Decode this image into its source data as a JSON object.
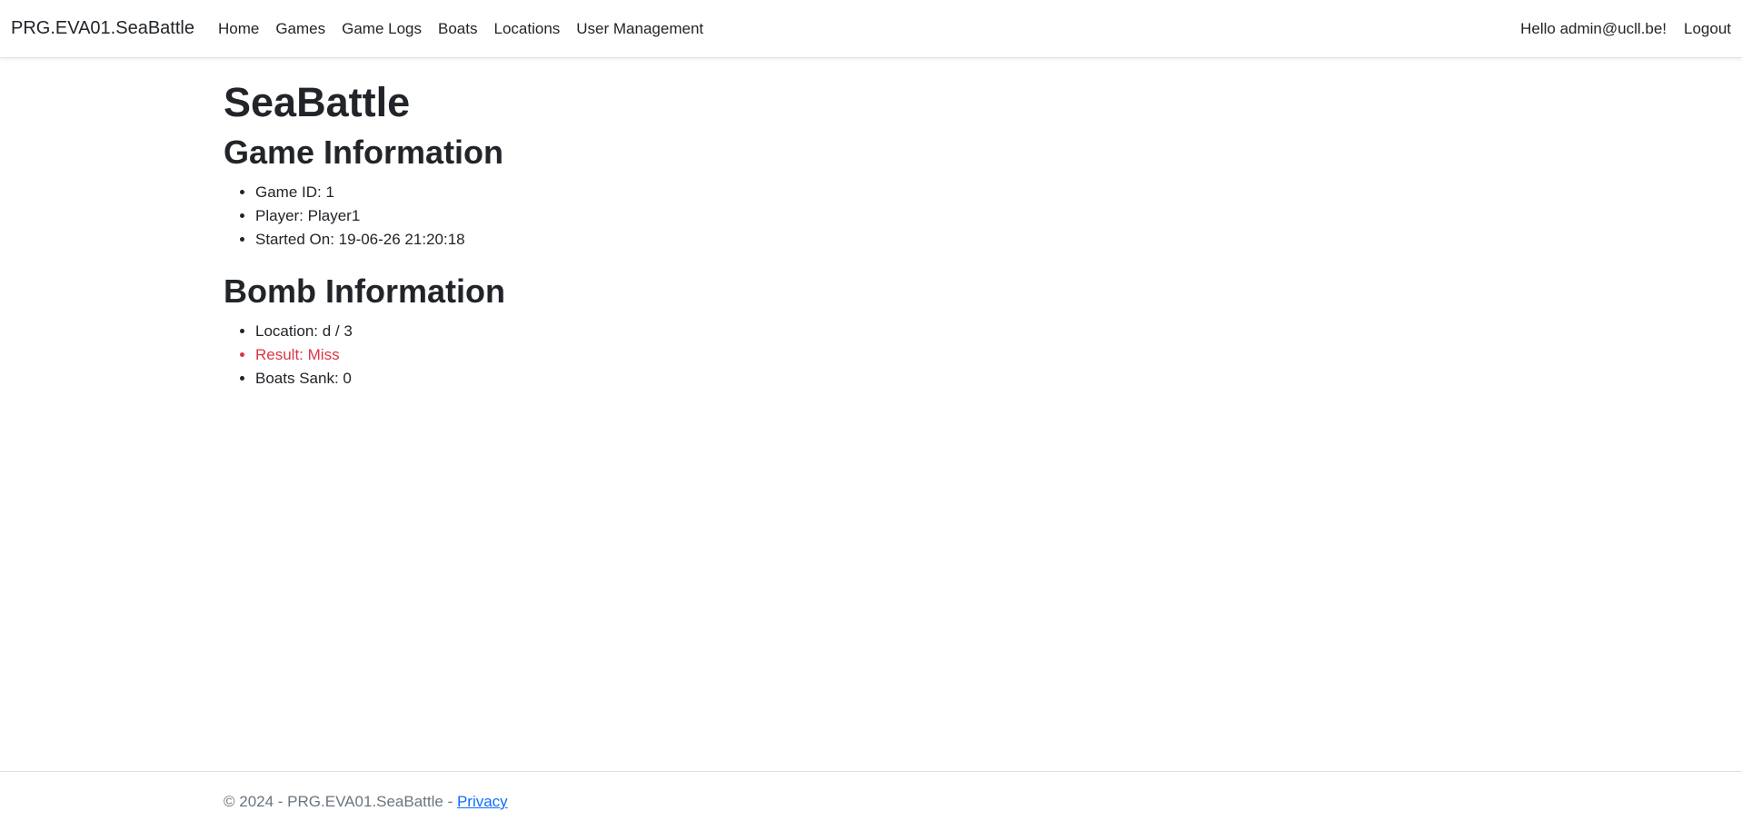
{
  "navbar": {
    "brand": "PRG.EVA01.SeaBattle",
    "links": [
      {
        "label": "Home"
      },
      {
        "label": "Games"
      },
      {
        "label": "Game Logs"
      },
      {
        "label": "Boats"
      },
      {
        "label": "Locations"
      },
      {
        "label": "User Management"
      }
    ],
    "greeting": "Hello admin@ucll.be!",
    "logout": "Logout"
  },
  "main": {
    "title": "SeaBattle",
    "game_section": {
      "heading": "Game Information",
      "items": [
        "Game ID: 1",
        "Player: Player1",
        "Started On: 19-06-26 21:20:18"
      ]
    },
    "bomb_section": {
      "heading": "Bomb Information",
      "location": "Location: d / 3",
      "result": "Result: Miss",
      "boats_sank": "Boats Sank: 0"
    }
  },
  "footer": {
    "text": "© 2024 - PRG.EVA01.SeaBattle - ",
    "privacy_link": "Privacy"
  },
  "colors": {
    "miss": "#dc3545",
    "link": "#0d6efd",
    "muted": "#6c757d"
  }
}
